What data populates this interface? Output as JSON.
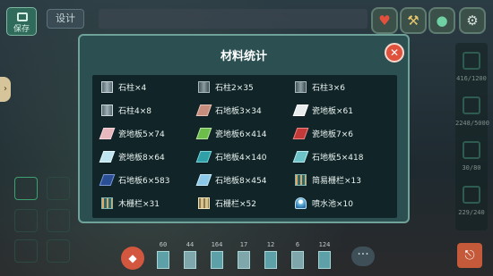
{
  "topbar": {
    "save_label": "保存",
    "design_tab": "设计"
  },
  "left_edge": {
    "arrow": "›"
  },
  "bottom": {
    "slots": [
      {
        "count": "60"
      },
      {
        "count": "44"
      },
      {
        "count": "164"
      },
      {
        "count": "17"
      },
      {
        "count": "12"
      },
      {
        "count": "6"
      },
      {
        "count": "124"
      }
    ],
    "more": "···"
  },
  "right_panel": {
    "counts": [
      "416/1200",
      "2248/5000",
      "30/80",
      "229/240"
    ]
  },
  "dialog": {
    "title": "材料统计",
    "close": "✕",
    "items": [
      {
        "label": "石柱×4",
        "icon": "stone-pillar"
      },
      {
        "label": "石柱2×35",
        "icon": "stone-pillar-2"
      },
      {
        "label": "石柱3×6",
        "icon": "stone-pillar-3"
      },
      {
        "label": "石柱4×8",
        "icon": "stone-pillar-4"
      },
      {
        "label": "石地板3×34",
        "icon": "stone-floor-red"
      },
      {
        "label": "瓷地板×61",
        "icon": "ceramic-floor-white"
      },
      {
        "label": "瓷地板5×74",
        "icon": "ceramic-floor-pink"
      },
      {
        "label": "瓷地板6×414",
        "icon": "ceramic-floor-green"
      },
      {
        "label": "瓷地板7×6",
        "icon": "ceramic-floor-red"
      },
      {
        "label": "瓷地板8×64",
        "icon": "ceramic-floor-light"
      },
      {
        "label": "石地板4×140",
        "icon": "stone-floor-teal"
      },
      {
        "label": "石地板5×418",
        "icon": "stone-floor-lightteal"
      },
      {
        "label": "石地板6×583",
        "icon": "stone-floor-navy"
      },
      {
        "label": "石地板8×454",
        "icon": "stone-floor-skyblue"
      },
      {
        "label": "简易栅栏×13",
        "icon": "simple-fence"
      },
      {
        "label": "木栅栏×31",
        "icon": "wood-fence"
      },
      {
        "label": "石栅栏×52",
        "icon": "stone-fence"
      },
      {
        "label": "喷水池×10",
        "icon": "fountain"
      }
    ]
  }
}
